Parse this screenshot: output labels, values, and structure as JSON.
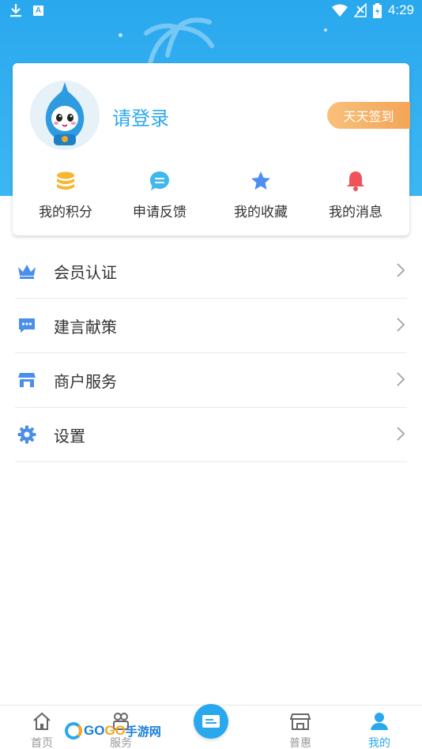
{
  "status_bar": {
    "time": "4:29",
    "left_icons": [
      "download-icon",
      "a-badge-icon"
    ],
    "right_icons": [
      "wifi-icon",
      "no-signal-icon",
      "battery-icon"
    ]
  },
  "profile": {
    "login_prompt": "请登录",
    "signin_button": "天天签到",
    "quick_links": [
      {
        "label": "我的积分",
        "icon": "coins-icon",
        "color": "#f5b731"
      },
      {
        "label": "申请反馈",
        "icon": "feedback-chat-icon",
        "color": "#3fb8ee"
      },
      {
        "label": "我的收藏",
        "icon": "star-icon",
        "color": "#4f8ff0"
      },
      {
        "label": "我的消息",
        "icon": "bell-icon",
        "color": "#f0525a"
      }
    ]
  },
  "menu": [
    {
      "label": "会员认证",
      "icon": "crown-icon"
    },
    {
      "label": "建言献策",
      "icon": "message-dots-icon"
    },
    {
      "label": "商户服务",
      "icon": "store-icon"
    },
    {
      "label": "设置",
      "icon": "gear-icon"
    }
  ],
  "tabbar": {
    "tabs": [
      {
        "label": "首页",
        "icon": "home-icon",
        "active": false
      },
      {
        "label": "服务",
        "icon": "service-icon",
        "active": false
      },
      {
        "label": "普惠",
        "icon": "shop-icon",
        "active": false
      },
      {
        "label": "我的",
        "icon": "person-icon",
        "active": true
      }
    ],
    "center_icon": "card-icon"
  },
  "watermark": {
    "text_a": "GO",
    "text_b": "GO",
    "text_c": "手游网"
  },
  "colors": {
    "primary": "#2aa8ee",
    "signin": "#f4a558"
  }
}
